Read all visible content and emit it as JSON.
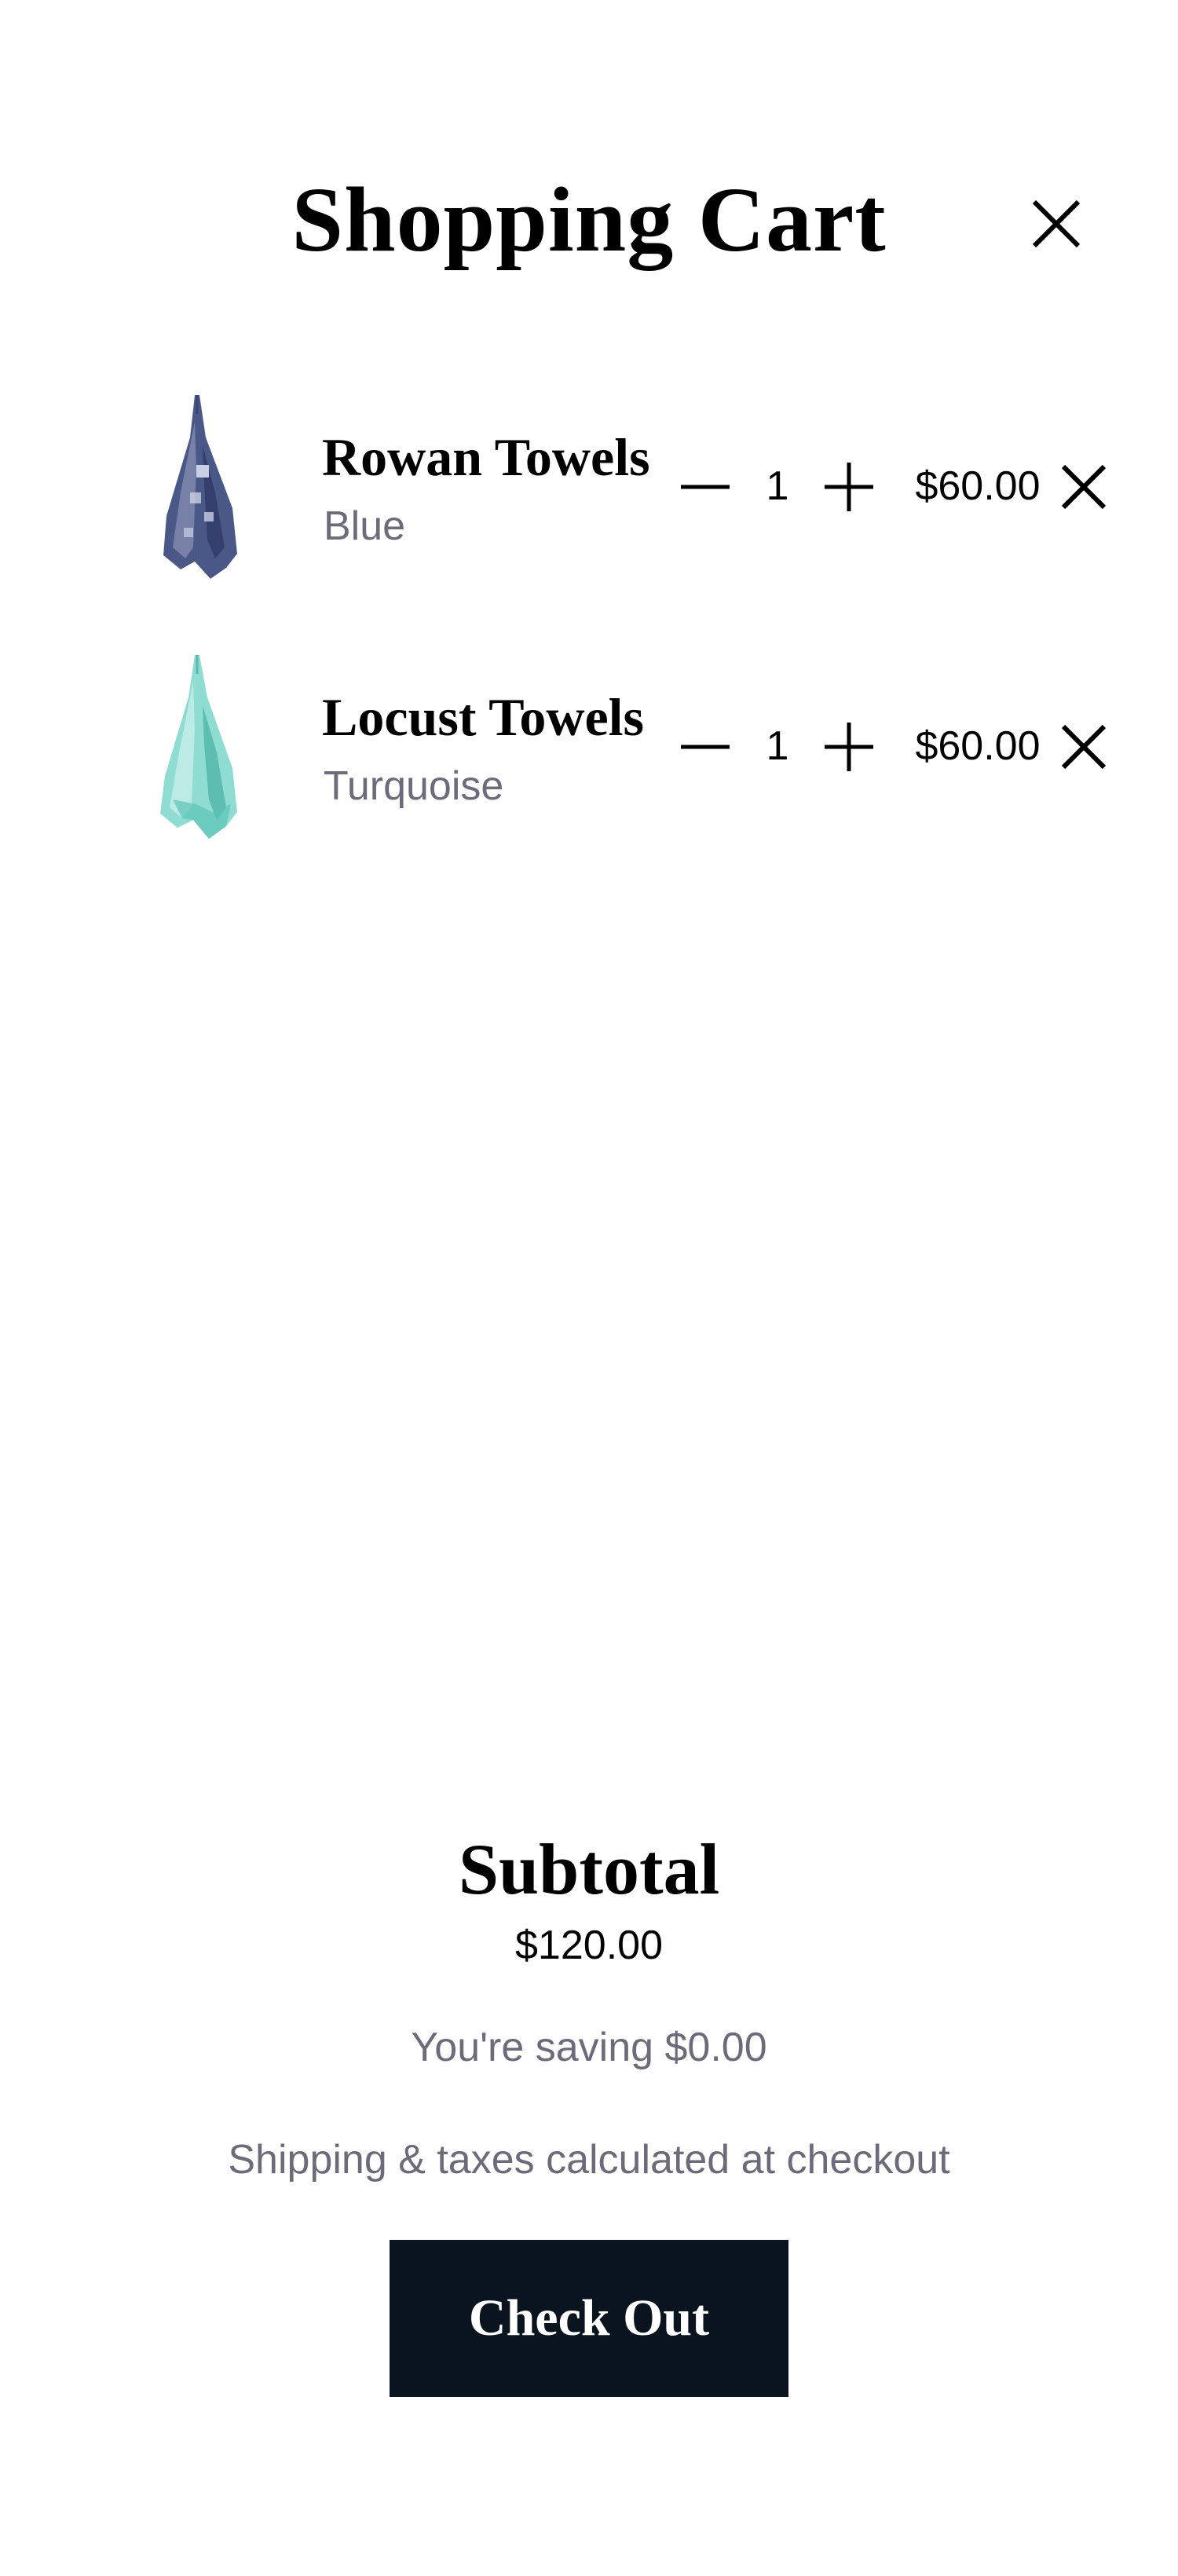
{
  "header": {
    "title": "Shopping Cart",
    "close_icon": "close-icon"
  },
  "cart": {
    "items": [
      {
        "name": "Rowan Towels",
        "variant": "Blue",
        "quantity": "1",
        "price": "$60.00",
        "image": "towel-image-blue",
        "color": "#4a5888"
      },
      {
        "name": "Locust Towels",
        "variant": "Turquoise",
        "quantity": "1",
        "price": "$60.00",
        "image": "towel-image-turquoise",
        "color": "#7fd3c8"
      }
    ]
  },
  "summary": {
    "subtotal_label": "Subtotal",
    "subtotal_value": "$120.00",
    "savings_text": "You're saving $0.00",
    "shipping_note": "Shipping & taxes calculated at checkout",
    "checkout_label": "Check Out"
  },
  "colors": {
    "primary_text": "#000000",
    "muted_text": "#6b6b7b",
    "checkout_background": "#0a141e",
    "checkout_text": "#ffffff"
  }
}
